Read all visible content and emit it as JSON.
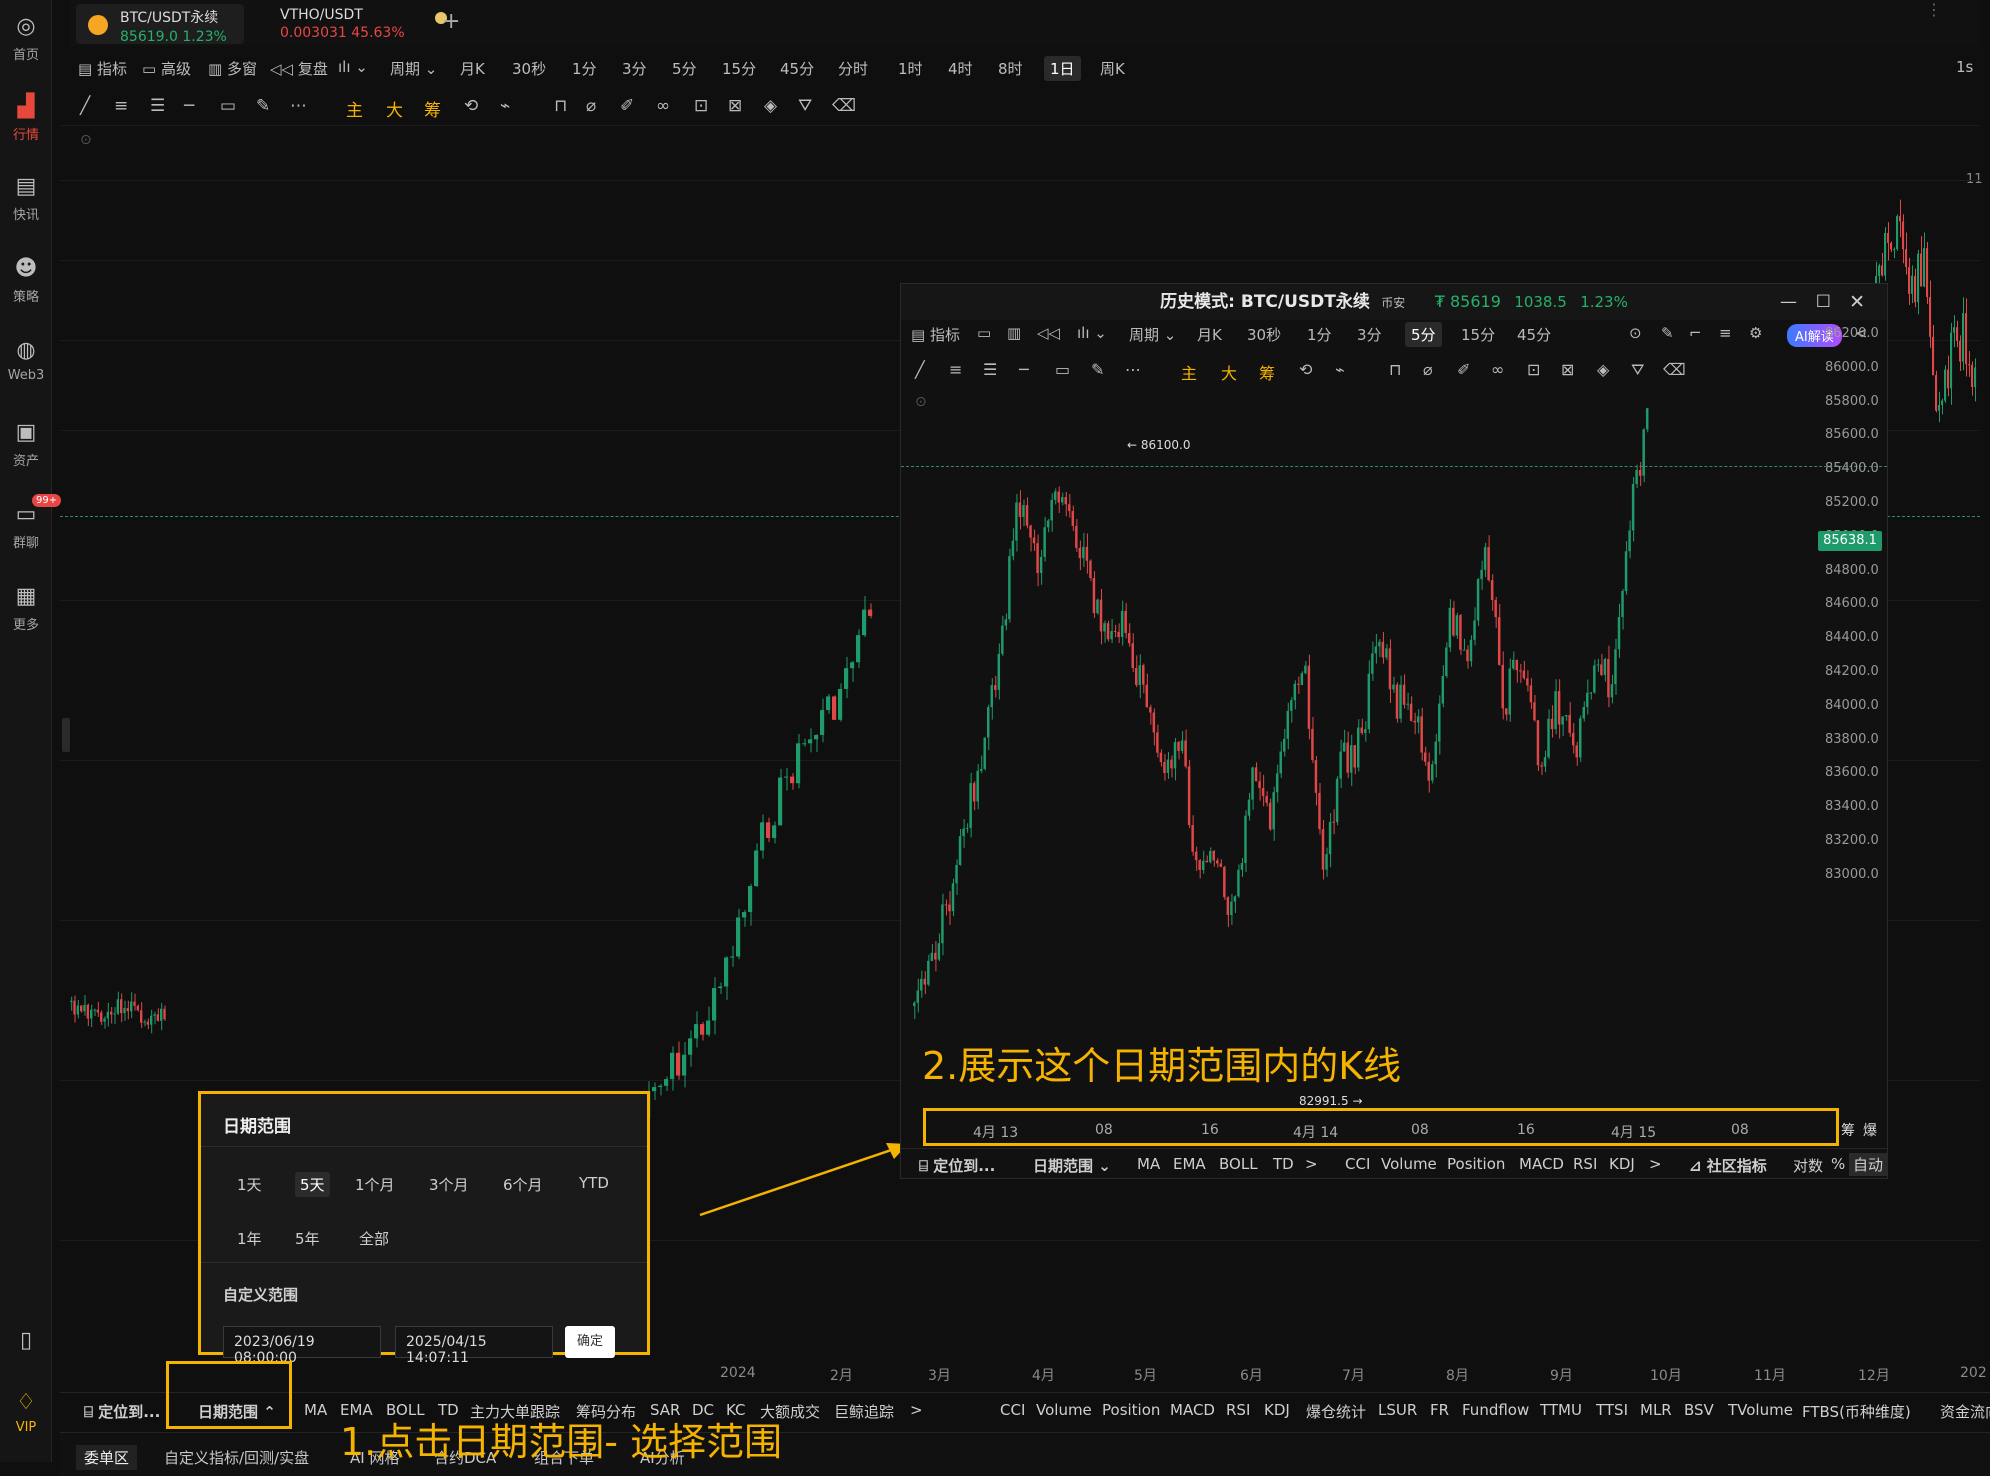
{
  "sidebar": {
    "items": [
      {
        "label": "首页",
        "icon": "home-icon"
      },
      {
        "label": "行情",
        "icon": "bar-chart-icon"
      },
      {
        "label": "快讯",
        "icon": "news-icon"
      },
      {
        "label": "策略",
        "icon": "robot-icon"
      },
      {
        "label": "Web3",
        "icon": "web3-icon"
      },
      {
        "label": "资产",
        "icon": "wallet-icon"
      },
      {
        "label": "群聊",
        "icon": "chat-icon"
      },
      {
        "label": "更多",
        "icon": "grid-icon"
      }
    ],
    "chat_badge": "99+",
    "vip_label": "VIP"
  },
  "tabs": [
    {
      "name": "BTC/USDT永续",
      "value": "85619.0  1.23%"
    },
    {
      "name": "VTHO/USDT",
      "value": "0.003031  45.63%"
    }
  ],
  "add_tab": "+",
  "toolbar": {
    "items": [
      "指标",
      "高级",
      "多窗",
      "复盘",
      "ılı",
      "周期",
      "月K",
      "30秒",
      "1分",
      "3分",
      "5分",
      "15分",
      "45分",
      "分时",
      "1时",
      "4时",
      "8时",
      "1日",
      "周K"
    ],
    "selected": "1日",
    "right": "1s",
    "draw_colored": [
      "主",
      "大",
      "筹"
    ]
  },
  "main_chart": {
    "x_labels": [
      "2024",
      "2月",
      "3月",
      "4月",
      "5月",
      "6月",
      "7月",
      "8月",
      "9月",
      "10月",
      "11月",
      "12月",
      "202"
    ],
    "y_right_partial": "11"
  },
  "bottom_bar": {
    "items": [
      "定位到...",
      "日期范围",
      "MA",
      "EMA",
      "BOLL",
      "TD",
      "主力大单跟踪",
      "筹码分布",
      "SAR",
      "DC",
      "KC",
      "大额成交",
      "巨鲸追踪",
      ">",
      "CCI",
      "Volume",
      "Position",
      "MACD",
      "RSI",
      "KDJ",
      "爆仓统计",
      "LSUR",
      "FR",
      "Fundflow",
      "TTMU",
      "TTSI",
      "MLR",
      "BSV",
      "TVolume",
      "FTBS(币种维度)",
      "资金流向"
    ]
  },
  "bottom_tabs": [
    "委单区",
    "自定义指标/回测/实盘",
    "AI 网格",
    "合约DCA",
    "组合下单",
    "AI分析"
  ],
  "date_popup": {
    "title": "日期范围",
    "options_row1": [
      "1天",
      "5天",
      "1个月",
      "3个月",
      "6个月",
      "YTD"
    ],
    "options_row2": [
      "1年",
      "5年",
      "全部"
    ],
    "selected": "5天",
    "custom_label": "自定义范围",
    "start": "2023/06/19 08:00:00",
    "end": "2025/04/15 14:07:11",
    "confirm": "确定"
  },
  "annotations": {
    "step1": "1.点击日期范围- 选择范围",
    "step2": "2.展示这个日期范围内的K线"
  },
  "history_window": {
    "title_prefix": "历史模式: BTC/USDT永续",
    "exchange": "币安",
    "price": "₮ 85619",
    "change": "1038.5",
    "change_pct": "1.23%",
    "toolbar": [
      "指标",
      "周期",
      "月K",
      "30秒",
      "1分",
      "3分",
      "5分",
      "15分",
      "45分"
    ],
    "selected": "5分",
    "ai_button": "AI解读",
    "y_labels": [
      "86200.0",
      "86000.0",
      "85800.0",
      "85600.0",
      "85400.0",
      "85200.0",
      "85000.0",
      "84800.0",
      "84600.0",
      "84400.0",
      "84200.0",
      "84000.0",
      "83800.0",
      "83600.0",
      "83400.0",
      "83200.0",
      "83000.0"
    ],
    "current_price": "85638.1",
    "high_label": "86100.0",
    "low_label": "82991.5",
    "x_labels": [
      "4月 13",
      "08",
      "16",
      "4月 14",
      "08",
      "16",
      "4月 15",
      "08"
    ],
    "x_right": [
      "筹",
      "爆"
    ],
    "bottom": [
      "定位到...",
      "日期范围",
      "MA",
      "EMA",
      "BOLL",
      "TD",
      ">",
      "CCI",
      "Volume",
      "Position",
      "MACD",
      "RSI",
      "KDJ",
      ">",
      "社区指标",
      "对数",
      "%",
      "自动"
    ]
  }
}
